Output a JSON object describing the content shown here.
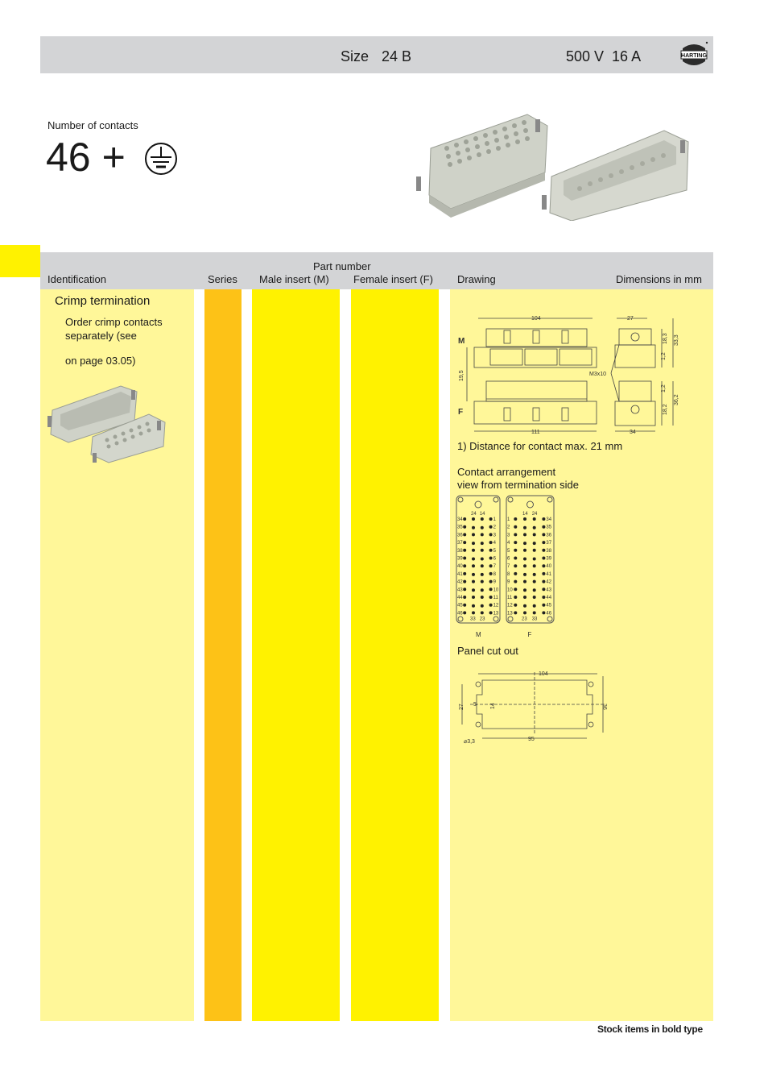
{
  "title_bar": {
    "size_label": "Size",
    "size_value": "24 B",
    "voltage": "500 V",
    "current": "16 A",
    "logo_text": "HARTING"
  },
  "contacts": {
    "label": "Number of contacts",
    "count": "46",
    "plus": "+",
    "earth_icon": "protective-earth-icon"
  },
  "table_header": {
    "part_number": "Part number",
    "identification": "Identification",
    "series": "Series",
    "male_insert": "Male insert (M)",
    "female_insert": "Female insert (F)",
    "drawing": "Drawing",
    "dimensions": "Dimensions in mm"
  },
  "identification": {
    "title": "Crimp termination",
    "note_line1": "Order crimp contacts separately (see",
    "note_line2": "on page 03.05)"
  },
  "drawing": {
    "dims": {
      "m_length": "104",
      "m_width": "27",
      "m_h1": "18,3",
      "m_h2": "33,3",
      "m_gap": "1,2",
      "offset": "19,5",
      "offset_note": "1)",
      "screw": "M3x10",
      "f_gap": "1,2",
      "f_h1": "18,2",
      "f_h2": "36,2",
      "f_length": "111",
      "f_width": "34",
      "label_m": "M",
      "label_f": "F"
    },
    "footnote": "1) Distance for contact max. 21 mm",
    "arrangement_line1": "Contact arrangement",
    "arrangement_line2": "view from termination side",
    "arrangement_m_label": "M",
    "arrangement_f_label": "F",
    "m_left_numbers": [
      "34",
      "35",
      "36",
      "37",
      "38",
      "39",
      "40",
      "41",
      "42",
      "43",
      "44",
      "45",
      "46"
    ],
    "m_right_numbers": [
      "1",
      "2",
      "3",
      "4",
      "5",
      "6",
      "7",
      "8",
      "9",
      "10",
      "11",
      "12",
      "13"
    ],
    "m_top_numbers": [
      "24",
      "14"
    ],
    "m_bottom_numbers": [
      "33",
      "23"
    ],
    "f_left_numbers": [
      "1",
      "2",
      "3",
      "4",
      "5",
      "6",
      "7",
      "8",
      "9",
      "10",
      "11",
      "12",
      "13"
    ],
    "f_right_numbers": [
      "34",
      "35",
      "36",
      "37",
      "38",
      "39",
      "40",
      "41",
      "42",
      "43",
      "44",
      "45",
      "46"
    ],
    "f_top_numbers": [
      "14",
      "24"
    ],
    "f_bottom_numbers": [
      "23",
      "33"
    ],
    "panel_label": "Panel cut out",
    "panel": {
      "length": "104",
      "inner_length": "95",
      "height": "36",
      "left_height": "27",
      "notch_h": "14",
      "notch_w": "5",
      "hole": "⌀3,3"
    }
  },
  "footer": {
    "stock_note": "Stock items in bold type"
  },
  "colors": {
    "header_gray": "#d3d4d6",
    "light_yellow": "#fff799",
    "yellow": "#fff200",
    "orange": "#fdc217"
  }
}
